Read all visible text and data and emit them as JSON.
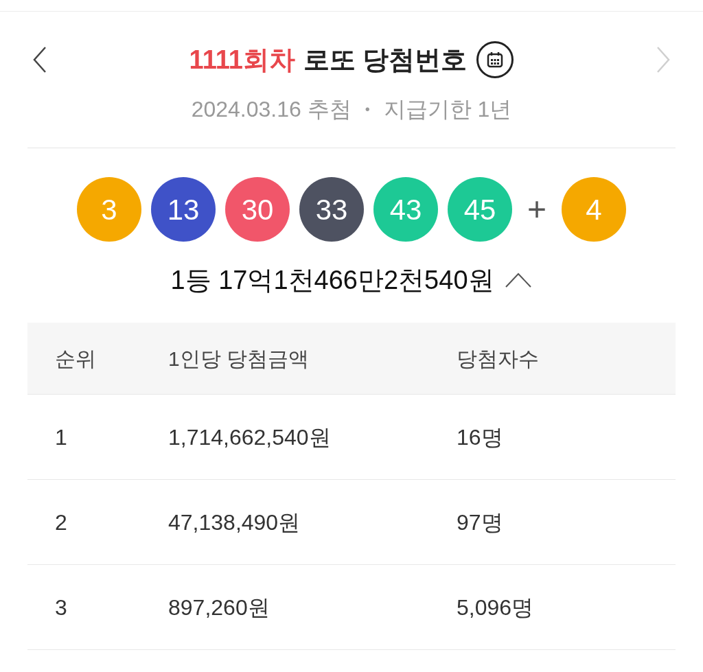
{
  "header": {
    "round": "1111회차",
    "title": "로또 당첨번호",
    "prev_disabled": false,
    "next_disabled": true
  },
  "subtitle": {
    "date": "2024.03.16 추첨",
    "separator": "•",
    "deadline": "지급기한 1년"
  },
  "balls": [
    {
      "number": "3",
      "color": "#f5a800"
    },
    {
      "number": "13",
      "color": "#3f52c8"
    },
    {
      "number": "30",
      "color": "#f1566a"
    },
    {
      "number": "33",
      "color": "#4e5261"
    },
    {
      "number": "43",
      "color": "#1dc995"
    },
    {
      "number": "45",
      "color": "#1dc995"
    }
  ],
  "plus": "+",
  "bonus_ball": {
    "number": "4",
    "color": "#f5a800"
  },
  "prize_summary": {
    "text": "1등 17억1천466만2천540원",
    "expanded": true
  },
  "table": {
    "columns": [
      "순위",
      "1인당 당첨금액",
      "당첨자수"
    ],
    "rows": [
      [
        "1",
        "1,714,662,540원",
        "16명"
      ],
      [
        "2",
        "47,138,490원",
        "97명"
      ],
      [
        "3",
        "897,260원",
        "5,096명"
      ]
    ]
  }
}
